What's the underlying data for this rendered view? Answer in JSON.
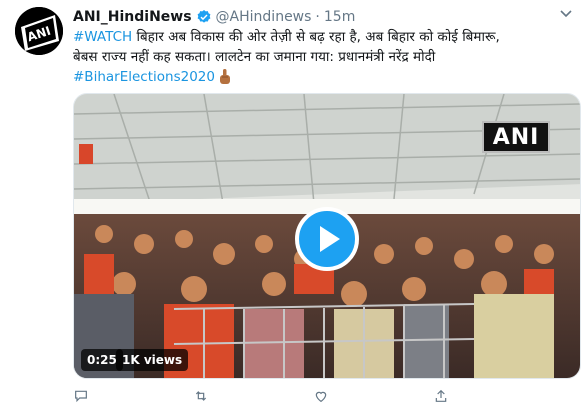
{
  "tweet": {
    "author_name": "ANI_HindiNews",
    "handle": "@AHindinews",
    "separator": "·",
    "time": "15m",
    "body_line1_hashtag": "#WATCH",
    "body_line1_text": " बिहार अब विकास की ओर तेज़ी से बढ़ रहा है, अब बिहार को कोई बिमारू,",
    "body_line2": "बेबस राज्य नहीं कह सकता। लालटेन का जमाना गया: प्रधानमंत्री नरेंद्र मोदी",
    "body_line3_hashtag": "#BiharElections2020",
    "emoji": "pointing-finger"
  },
  "media": {
    "watermark": "ANI",
    "duration": "0:25",
    "views": "1K views"
  },
  "actions": {
    "reply_count": "",
    "retweet_count": "",
    "like_count": "",
    "share_count": ""
  },
  "colors": {
    "link": "#1b95e0",
    "verified": "#1da1f2",
    "secondary": "#657786"
  }
}
